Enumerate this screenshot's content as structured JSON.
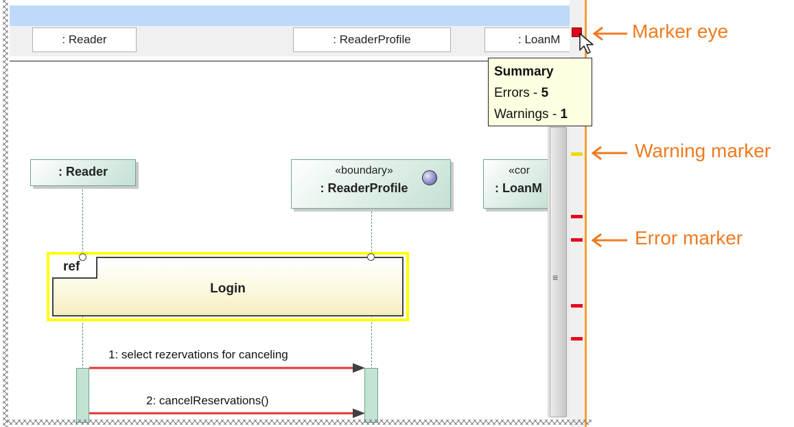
{
  "colors": {
    "error": "#e8001c",
    "warning": "#f0d800",
    "message_arrow": "#e63030",
    "callout": "#f07a20",
    "selection": "#ffff00",
    "lifeline_border": "#6aa58e"
  },
  "header_boxes": [
    {
      "label": ": Reader"
    },
    {
      "label": ": ReaderProfile"
    },
    {
      "label": ": LoanM"
    }
  ],
  "lifelines": [
    {
      "name": ": Reader",
      "stereotype": ""
    },
    {
      "name": ": ReaderProfile",
      "stereotype": "«boundary»",
      "icon": "boundary-icon"
    },
    {
      "name": ": LoanM",
      "stereotype": "«cor"
    }
  ],
  "ref_frame": {
    "tag": "ref",
    "name": "Login"
  },
  "messages": [
    {
      "label": "1: select rezervations for canceling"
    },
    {
      "label": "2: cancelReservations()"
    }
  ],
  "tooltip": {
    "title": "Summary",
    "errors_label": "Errors - ",
    "errors_count": "5",
    "warnings_label": "Warnings - ",
    "warnings_count": "1"
  },
  "scrollbar": {
    "grip_icon": "grip-lines-icon"
  },
  "cursor_icon": "mouse-pointer-icon",
  "markers": {
    "warnings": 1,
    "errors_visible": 4
  },
  "callouts": {
    "marker_eye": "Marker eye",
    "warning_marker": "Warning marker",
    "error_marker": "Error marker"
  }
}
